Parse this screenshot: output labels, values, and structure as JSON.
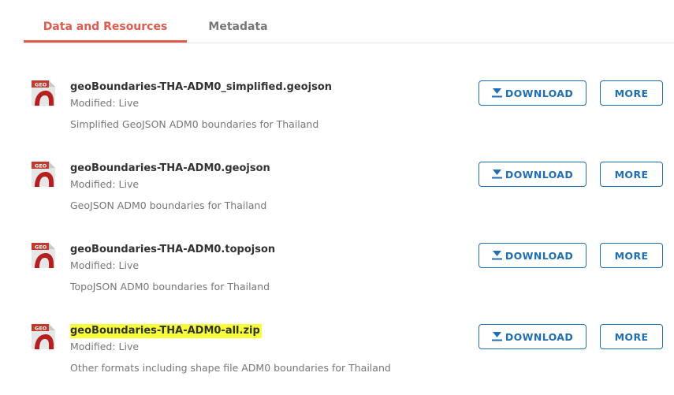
{
  "tabs": [
    {
      "label": "Data and Resources",
      "active": true
    },
    {
      "label": "Metadata",
      "active": false
    }
  ],
  "icon_label": "GEO",
  "colors": {
    "accent": "#e05a4e",
    "button": "#1f6fb2",
    "highlight": "#f7ff3a"
  },
  "resources": [
    {
      "title": "geoBoundaries-THA-ADM0_simplified.geojson",
      "modified": "Modified: Live",
      "description": "Simplified GeoJSON ADM0 boundaries for Thailand",
      "download_label": "DOWNLOAD",
      "more_label": "MORE"
    },
    {
      "title": "geoBoundaries-THA-ADM0.geojson",
      "modified": "Modified: Live",
      "description": "GeoJSON ADM0 boundaries for Thailand",
      "download_label": "DOWNLOAD",
      "more_label": "MORE"
    },
    {
      "title": "geoBoundaries-THA-ADM0.topojson",
      "modified": "Modified: Live",
      "description": "TopoJSON ADM0 boundaries for Thailand",
      "download_label": "DOWNLOAD",
      "more_label": "MORE"
    },
    {
      "title": "geoBoundaries-THA-ADM0-all.zip",
      "modified": "Modified: Live",
      "description": "Other formats including shape file ADM0 boundaries for Thailand",
      "download_label": "DOWNLOAD",
      "more_label": "MORE",
      "highlighted": true
    }
  ]
}
